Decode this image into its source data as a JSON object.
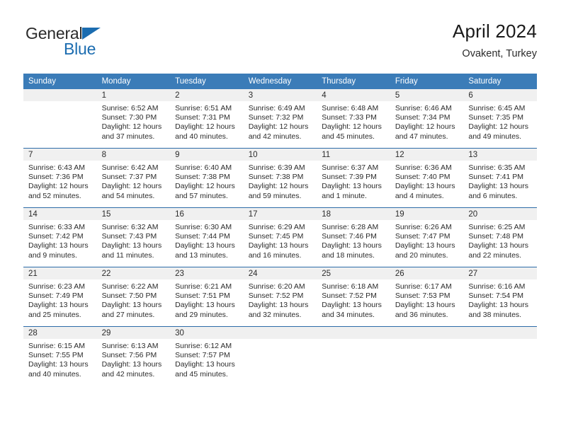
{
  "brand": {
    "name_top": "General",
    "name_bottom": "Blue",
    "color_dark": "#2b2b2b",
    "color_blue": "#1b6cb0"
  },
  "header": {
    "title": "April 2024",
    "location": "Ovakent, Turkey"
  },
  "theme": {
    "header_blue": "#3b7cb8",
    "row_divider_blue": "#2d6ca8",
    "daynum_band": "#f0f0f0",
    "text": "#2b2b2b"
  },
  "weekdays": [
    "Sunday",
    "Monday",
    "Tuesday",
    "Wednesday",
    "Thursday",
    "Friday",
    "Saturday"
  ],
  "weeks": [
    [
      {
        "day": "",
        "sunrise": "",
        "sunset": "",
        "daylight_1": "",
        "daylight_2": ""
      },
      {
        "day": "1",
        "sunrise": "Sunrise: 6:52 AM",
        "sunset": "Sunset: 7:30 PM",
        "daylight_1": "Daylight: 12 hours",
        "daylight_2": "and 37 minutes."
      },
      {
        "day": "2",
        "sunrise": "Sunrise: 6:51 AM",
        "sunset": "Sunset: 7:31 PM",
        "daylight_1": "Daylight: 12 hours",
        "daylight_2": "and 40 minutes."
      },
      {
        "day": "3",
        "sunrise": "Sunrise: 6:49 AM",
        "sunset": "Sunset: 7:32 PM",
        "daylight_1": "Daylight: 12 hours",
        "daylight_2": "and 42 minutes."
      },
      {
        "day": "4",
        "sunrise": "Sunrise: 6:48 AM",
        "sunset": "Sunset: 7:33 PM",
        "daylight_1": "Daylight: 12 hours",
        "daylight_2": "and 45 minutes."
      },
      {
        "day": "5",
        "sunrise": "Sunrise: 6:46 AM",
        "sunset": "Sunset: 7:34 PM",
        "daylight_1": "Daylight: 12 hours",
        "daylight_2": "and 47 minutes."
      },
      {
        "day": "6",
        "sunrise": "Sunrise: 6:45 AM",
        "sunset": "Sunset: 7:35 PM",
        "daylight_1": "Daylight: 12 hours",
        "daylight_2": "and 49 minutes."
      }
    ],
    [
      {
        "day": "7",
        "sunrise": "Sunrise: 6:43 AM",
        "sunset": "Sunset: 7:36 PM",
        "daylight_1": "Daylight: 12 hours",
        "daylight_2": "and 52 minutes."
      },
      {
        "day": "8",
        "sunrise": "Sunrise: 6:42 AM",
        "sunset": "Sunset: 7:37 PM",
        "daylight_1": "Daylight: 12 hours",
        "daylight_2": "and 54 minutes."
      },
      {
        "day": "9",
        "sunrise": "Sunrise: 6:40 AM",
        "sunset": "Sunset: 7:38 PM",
        "daylight_1": "Daylight: 12 hours",
        "daylight_2": "and 57 minutes."
      },
      {
        "day": "10",
        "sunrise": "Sunrise: 6:39 AM",
        "sunset": "Sunset: 7:38 PM",
        "daylight_1": "Daylight: 12 hours",
        "daylight_2": "and 59 minutes."
      },
      {
        "day": "11",
        "sunrise": "Sunrise: 6:37 AM",
        "sunset": "Sunset: 7:39 PM",
        "daylight_1": "Daylight: 13 hours",
        "daylight_2": "and 1 minute."
      },
      {
        "day": "12",
        "sunrise": "Sunrise: 6:36 AM",
        "sunset": "Sunset: 7:40 PM",
        "daylight_1": "Daylight: 13 hours",
        "daylight_2": "and 4 minutes."
      },
      {
        "day": "13",
        "sunrise": "Sunrise: 6:35 AM",
        "sunset": "Sunset: 7:41 PM",
        "daylight_1": "Daylight: 13 hours",
        "daylight_2": "and 6 minutes."
      }
    ],
    [
      {
        "day": "14",
        "sunrise": "Sunrise: 6:33 AM",
        "sunset": "Sunset: 7:42 PM",
        "daylight_1": "Daylight: 13 hours",
        "daylight_2": "and 9 minutes."
      },
      {
        "day": "15",
        "sunrise": "Sunrise: 6:32 AM",
        "sunset": "Sunset: 7:43 PM",
        "daylight_1": "Daylight: 13 hours",
        "daylight_2": "and 11 minutes."
      },
      {
        "day": "16",
        "sunrise": "Sunrise: 6:30 AM",
        "sunset": "Sunset: 7:44 PM",
        "daylight_1": "Daylight: 13 hours",
        "daylight_2": "and 13 minutes."
      },
      {
        "day": "17",
        "sunrise": "Sunrise: 6:29 AM",
        "sunset": "Sunset: 7:45 PM",
        "daylight_1": "Daylight: 13 hours",
        "daylight_2": "and 16 minutes."
      },
      {
        "day": "18",
        "sunrise": "Sunrise: 6:28 AM",
        "sunset": "Sunset: 7:46 PM",
        "daylight_1": "Daylight: 13 hours",
        "daylight_2": "and 18 minutes."
      },
      {
        "day": "19",
        "sunrise": "Sunrise: 6:26 AM",
        "sunset": "Sunset: 7:47 PM",
        "daylight_1": "Daylight: 13 hours",
        "daylight_2": "and 20 minutes."
      },
      {
        "day": "20",
        "sunrise": "Sunrise: 6:25 AM",
        "sunset": "Sunset: 7:48 PM",
        "daylight_1": "Daylight: 13 hours",
        "daylight_2": "and 22 minutes."
      }
    ],
    [
      {
        "day": "21",
        "sunrise": "Sunrise: 6:23 AM",
        "sunset": "Sunset: 7:49 PM",
        "daylight_1": "Daylight: 13 hours",
        "daylight_2": "and 25 minutes."
      },
      {
        "day": "22",
        "sunrise": "Sunrise: 6:22 AM",
        "sunset": "Sunset: 7:50 PM",
        "daylight_1": "Daylight: 13 hours",
        "daylight_2": "and 27 minutes."
      },
      {
        "day": "23",
        "sunrise": "Sunrise: 6:21 AM",
        "sunset": "Sunset: 7:51 PM",
        "daylight_1": "Daylight: 13 hours",
        "daylight_2": "and 29 minutes."
      },
      {
        "day": "24",
        "sunrise": "Sunrise: 6:20 AM",
        "sunset": "Sunset: 7:52 PM",
        "daylight_1": "Daylight: 13 hours",
        "daylight_2": "and 32 minutes."
      },
      {
        "day": "25",
        "sunrise": "Sunrise: 6:18 AM",
        "sunset": "Sunset: 7:52 PM",
        "daylight_1": "Daylight: 13 hours",
        "daylight_2": "and 34 minutes."
      },
      {
        "day": "26",
        "sunrise": "Sunrise: 6:17 AM",
        "sunset": "Sunset: 7:53 PM",
        "daylight_1": "Daylight: 13 hours",
        "daylight_2": "and 36 minutes."
      },
      {
        "day": "27",
        "sunrise": "Sunrise: 6:16 AM",
        "sunset": "Sunset: 7:54 PM",
        "daylight_1": "Daylight: 13 hours",
        "daylight_2": "and 38 minutes."
      }
    ],
    [
      {
        "day": "28",
        "sunrise": "Sunrise: 6:15 AM",
        "sunset": "Sunset: 7:55 PM",
        "daylight_1": "Daylight: 13 hours",
        "daylight_2": "and 40 minutes."
      },
      {
        "day": "29",
        "sunrise": "Sunrise: 6:13 AM",
        "sunset": "Sunset: 7:56 PM",
        "daylight_1": "Daylight: 13 hours",
        "daylight_2": "and 42 minutes."
      },
      {
        "day": "30",
        "sunrise": "Sunrise: 6:12 AM",
        "sunset": "Sunset: 7:57 PM",
        "daylight_1": "Daylight: 13 hours",
        "daylight_2": "and 45 minutes."
      },
      {
        "day": "",
        "sunrise": "",
        "sunset": "",
        "daylight_1": "",
        "daylight_2": ""
      },
      {
        "day": "",
        "sunrise": "",
        "sunset": "",
        "daylight_1": "",
        "daylight_2": ""
      },
      {
        "day": "",
        "sunrise": "",
        "sunset": "",
        "daylight_1": "",
        "daylight_2": ""
      },
      {
        "day": "",
        "sunrise": "",
        "sunset": "",
        "daylight_1": "",
        "daylight_2": ""
      }
    ]
  ]
}
